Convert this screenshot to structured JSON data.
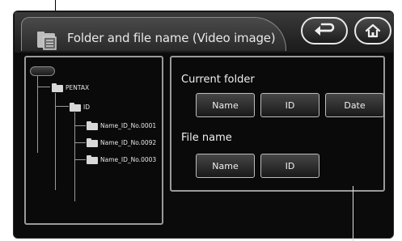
{
  "title": {
    "text": "Folder and file name (Video image)",
    "icon": "folder-document-icon"
  },
  "buttons": {
    "back": {
      "icon": "back-arrow-icon"
    },
    "home": {
      "icon": "home-icon"
    }
  },
  "tree": {
    "root_label": "",
    "items": [
      {
        "label": "PENTAX",
        "icon": "folder-icon"
      },
      {
        "label": "ID",
        "icon": "folder-icon"
      },
      {
        "label": "Name_ID_No.0001",
        "icon": "folder-icon"
      },
      {
        "label": "Name_ID_No.0092",
        "icon": "folder-icon"
      },
      {
        "label": "Name_ID_No.0003",
        "icon": "folder-icon"
      }
    ]
  },
  "current_folder": {
    "heading": "Current folder",
    "options": [
      "Name",
      "ID",
      "Date"
    ]
  },
  "file_name": {
    "heading": "File name",
    "options": [
      "Name",
      "ID"
    ]
  },
  "colors": {
    "screen_bg": "#0b0b0b",
    "panel_border": "#9a9a9a",
    "text": "#f0f0f0"
  }
}
